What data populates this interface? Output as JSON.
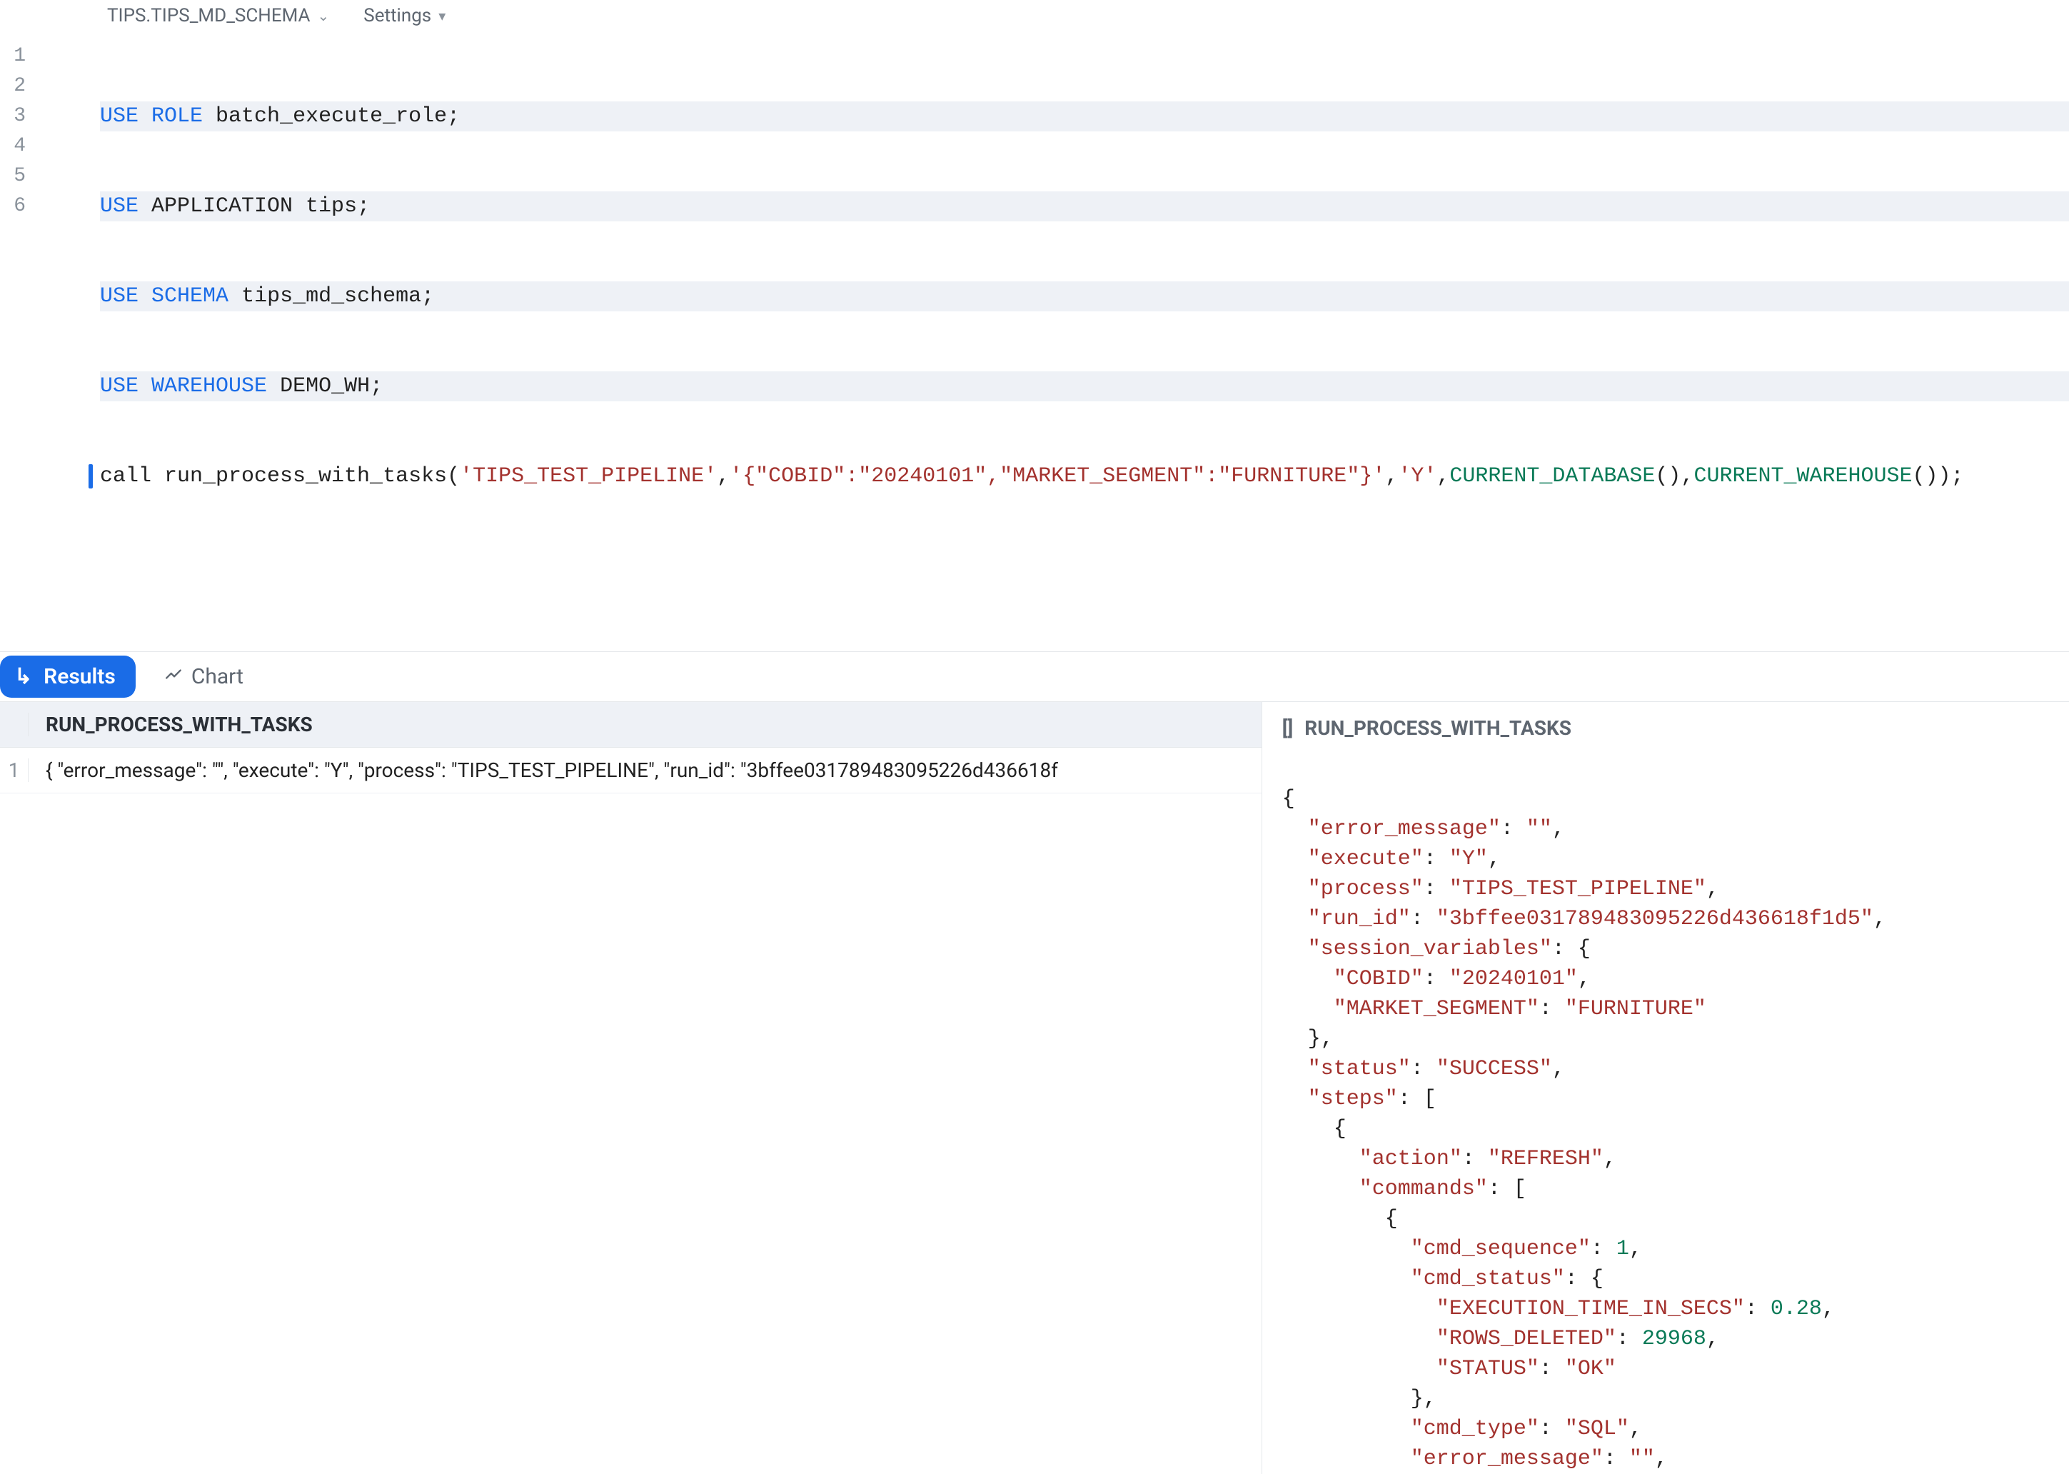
{
  "context": {
    "schema_label": "TIPS.TIPS_MD_SCHEMA",
    "settings_label": "Settings"
  },
  "editor": {
    "lines": [
      "1",
      "2",
      "3",
      "4",
      "5",
      "6"
    ],
    "code": {
      "l1_kw1": "USE",
      "l1_kw2": "ROLE",
      "l1_rest": " batch_execute_role;",
      "l2_kw1": "USE",
      "l2_rest": " APPLICATION tips;",
      "l3_kw1": "USE",
      "l3_kw2": "SCHEMA",
      "l3_rest": " tips_md_schema;",
      "l4_kw1": "USE",
      "l4_kw2": "WAREHOUSE",
      "l4_rest": " DEMO_WH;",
      "l5_a": "call run_process_with_tasks(",
      "l5_s1": "'TIPS_TEST_PIPELINE'",
      "l5_c1": ",",
      "l5_s2": "'{\"COBID\":\"20240101\",\"MARKET_SEGMENT\":\"FURNITURE\"}'",
      "l5_c2": ",",
      "l5_s3": "'Y'",
      "l5_c3": ",",
      "l5_fn1": "CURRENT_DATABASE",
      "l5_p1": "(),",
      "l5_fn2": "CURRENT_WAREHOUSE",
      "l5_p2": "());"
    }
  },
  "tabs": {
    "results_label": "Results",
    "chart_label": "Chart"
  },
  "grid": {
    "rownum": "1",
    "column_header": "RUN_PROCESS_WITH_TASKS",
    "row1_value": "{ \"error_message\": \"\", \"execute\": \"Y\", \"process\": \"TIPS_TEST_PIPELINE\", \"run_id\": \"3bffee031789483095226d436618f"
  },
  "detail": {
    "bracket": "[]",
    "title": "RUN_PROCESS_WITH_TASKS",
    "json": {
      "error_message": "",
      "execute": "Y",
      "process": "TIPS_TEST_PIPELINE",
      "run_id": "3bffee031789483095226d436618f1d5",
      "session_variables": {
        "COBID": "20240101",
        "MARKET_SEGMENT": "FURNITURE"
      },
      "status": "SUCCESS",
      "steps": [
        {
          "action": "REFRESH",
          "commands": [
            {
              "cmd_sequence": 1,
              "cmd_status": {
                "EXECUTION_TIME_IN_SECS": 0.28,
                "ROWS_DELETED": 29968,
                "STATUS": "OK"
              },
              "cmd_type": "SQL",
              "error_message": ""
            }
          ]
        }
      ]
    },
    "labels": {
      "open_brace": "{",
      "error_message": "\"error_message\"",
      "execute": "\"execute\"",
      "process": "\"process\"",
      "run_id": "\"run_id\"",
      "session_variables": "\"session_variables\"",
      "cobid": "\"COBID\"",
      "market_segment": "\"MARKET_SEGMENT\"",
      "status": "\"status\"",
      "steps": "\"steps\"",
      "action": "\"action\"",
      "commands": "\"commands\"",
      "cmd_sequence": "\"cmd_sequence\"",
      "cmd_status": "\"cmd_status\"",
      "exec_time": "\"EXECUTION_TIME_IN_SECS\"",
      "rows_deleted": "\"ROWS_DELETED\"",
      "status_inner": "\"STATUS\"",
      "cmd_type": "\"cmd_type\"",
      "v_empty": "\"\"",
      "v_Y": "\"Y\"",
      "v_process": "\"TIPS_TEST_PIPELINE\"",
      "v_runid": "\"3bffee031789483095226d436618f1d5\"",
      "v_cobid": "\"20240101\"",
      "v_mkt": "\"FURNITURE\"",
      "v_success": "\"SUCCESS\"",
      "v_refresh": "\"REFRESH\"",
      "v_1": "1",
      "v_028": "0.28",
      "v_29968": "29968",
      "v_ok": "\"OK\"",
      "v_sql": "\"SQL\""
    }
  }
}
